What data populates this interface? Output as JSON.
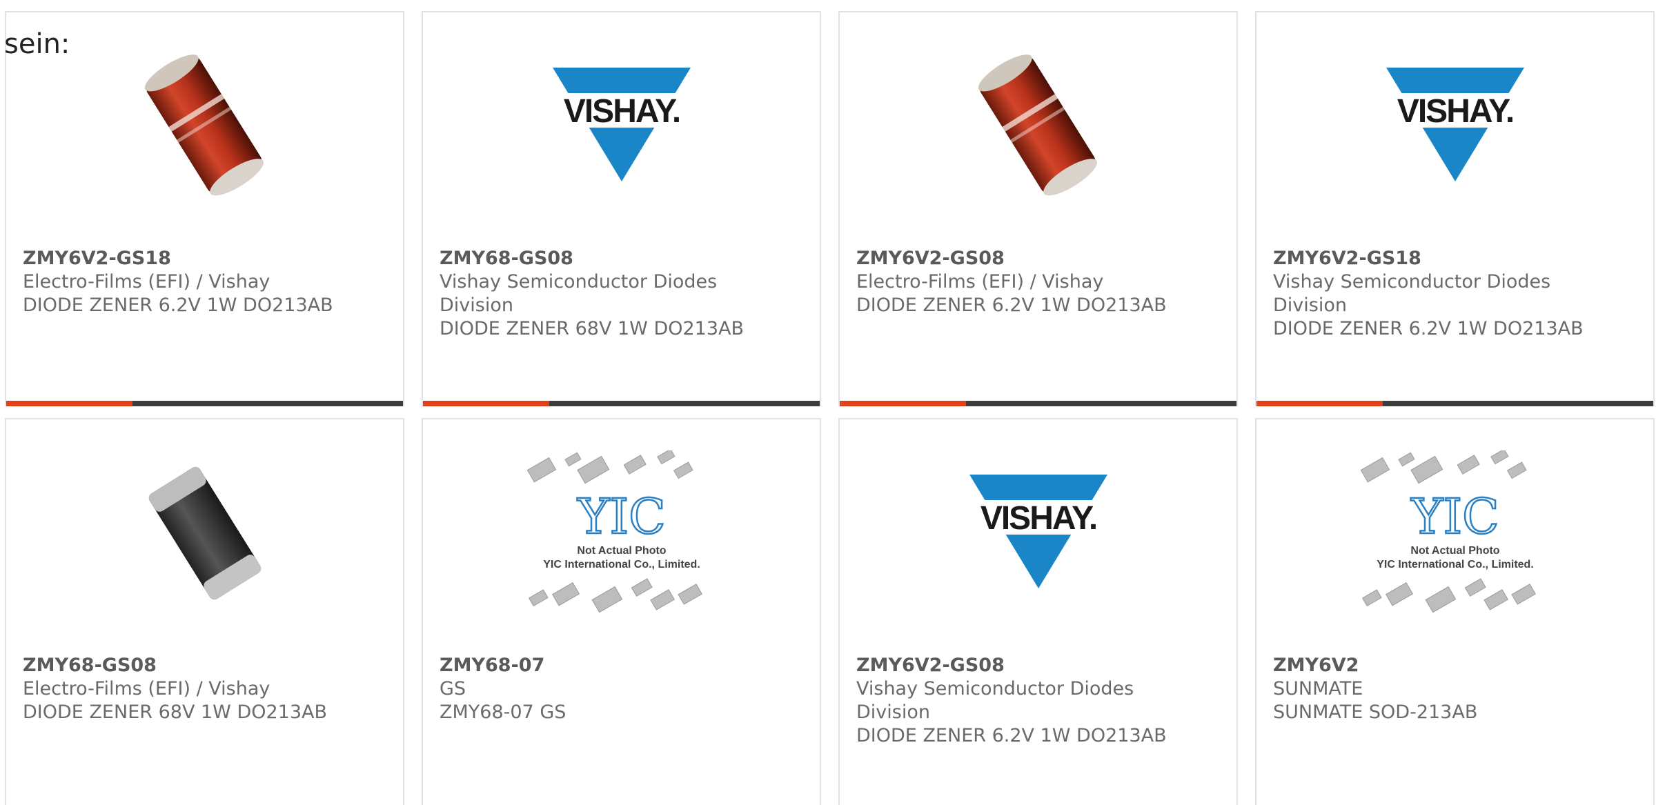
{
  "intro_text": "sein:",
  "colors": {
    "accent": "#e2401b",
    "bar": "#3c3c3c",
    "vishay_blue": "#1a86c8"
  },
  "yic_caption": {
    "line1": "Not Actual Photo",
    "line2": "YIC International Co., Limited."
  },
  "products": [
    {
      "part": "ZMY6V2-GS18",
      "maker_lines": [
        "Electro-Films (EFI) / Vishay"
      ],
      "desc": "DIODE ZENER 6.2V 1W DO213AB",
      "image": "red-diode-photo"
    },
    {
      "part": "ZMY68-GS08",
      "maker_lines": [
        "Vishay Semiconductor Diodes",
        "Division"
      ],
      "desc": "DIODE ZENER 68V 1W DO213AB",
      "image": "vishay-logo"
    },
    {
      "part": "ZMY6V2-GS08",
      "maker_lines": [
        "Electro-Films (EFI) / Vishay"
      ],
      "desc": "DIODE ZENER 6.2V 1W DO213AB",
      "image": "red-diode-photo"
    },
    {
      "part": "ZMY6V2-GS18",
      "maker_lines": [
        "Vishay Semiconductor Diodes",
        "Division"
      ],
      "desc": "DIODE ZENER 6.2V 1W DO213AB",
      "image": "vishay-logo"
    },
    {
      "part": "ZMY68-GS08",
      "maker_lines": [
        "Electro-Films (EFI) / Vishay"
      ],
      "desc": "DIODE ZENER 68V 1W DO213AB",
      "image": "black-diode-photo"
    },
    {
      "part": "ZMY68-07",
      "maker_lines": [
        "GS"
      ],
      "desc": "ZMY68-07 GS",
      "image": "yic-placeholder"
    },
    {
      "part": "ZMY6V2-GS08",
      "maker_lines": [
        "Vishay Semiconductor Diodes",
        "Division"
      ],
      "desc": "DIODE ZENER 6.2V 1W DO213AB",
      "image": "vishay-logo"
    },
    {
      "part": "ZMY6V2",
      "maker_lines": [
        "SUNMATE"
      ],
      "desc": "SUNMATE SOD-213AB",
      "image": "yic-placeholder"
    }
  ]
}
